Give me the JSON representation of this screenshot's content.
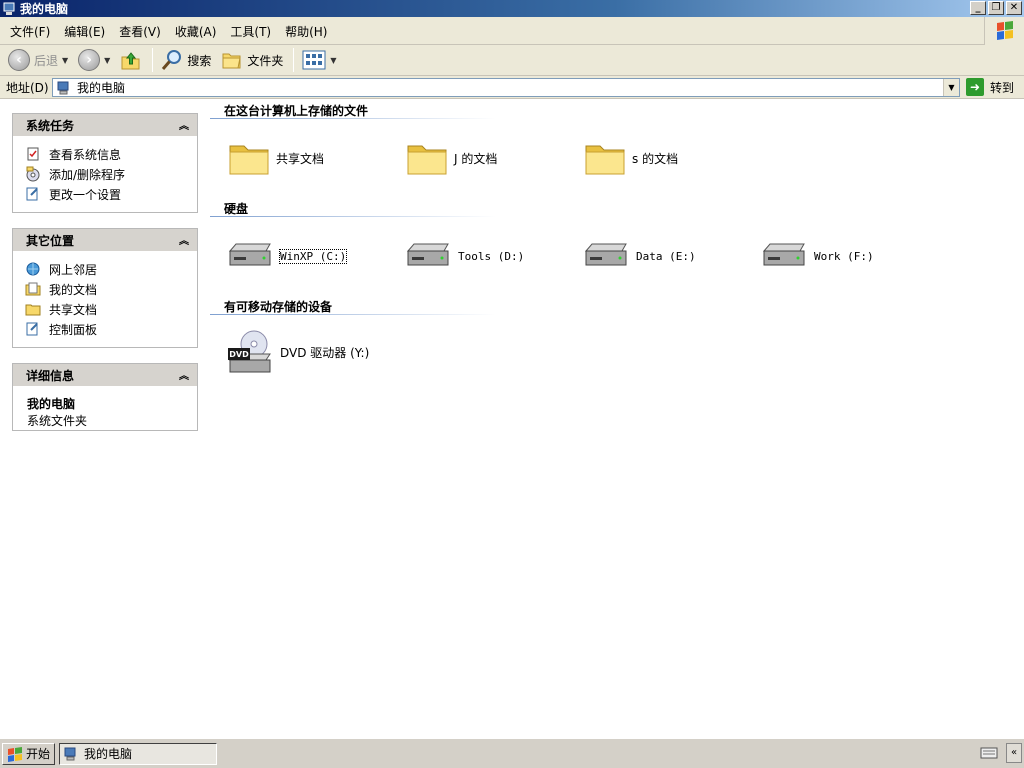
{
  "window": {
    "title": "我的电脑",
    "buttons": [
      "_",
      "❐",
      "✕"
    ]
  },
  "menu": [
    "文件(F)",
    "编辑(E)",
    "查看(V)",
    "收藏(A)",
    "工具(T)",
    "帮助(H)"
  ],
  "toolbar": {
    "back": "后退",
    "search": "搜索",
    "folders": "文件夹"
  },
  "address": {
    "label": "地址(D)",
    "value": "我的电脑",
    "go": "转到"
  },
  "panels": {
    "system_tasks": {
      "title": "系统任务",
      "items": [
        "查看系统信息",
        "添加/删除程序",
        "更改一个设置"
      ]
    },
    "other_places": {
      "title": "其它位置",
      "items": [
        "网上邻居",
        "我的文档",
        "共享文档",
        "控制面板"
      ]
    },
    "details": {
      "title": "详细信息",
      "name": "我的电脑",
      "desc": "系统文件夹"
    }
  },
  "sections": {
    "stored_files": {
      "title": "在这台计算机上存储的文件",
      "items": [
        "共享文档",
        "J 的文档",
        "s 的文档"
      ]
    },
    "hard_disks": {
      "title": "硬盘",
      "items": [
        "WinXP (C:)",
        "Tools (D:)",
        "Data (E:)",
        "Work (F:)"
      ]
    },
    "removable": {
      "title": "有可移动存储的设备",
      "items": [
        "DVD 驱动器 (Y:)"
      ]
    }
  },
  "taskbar": {
    "start": "开始",
    "task": "我的电脑"
  },
  "colors": {
    "title_dark": "#0a246a",
    "title_light": "#a6caf0",
    "chrome": "#ece9d8",
    "panel_head": "#d6d3ce"
  }
}
